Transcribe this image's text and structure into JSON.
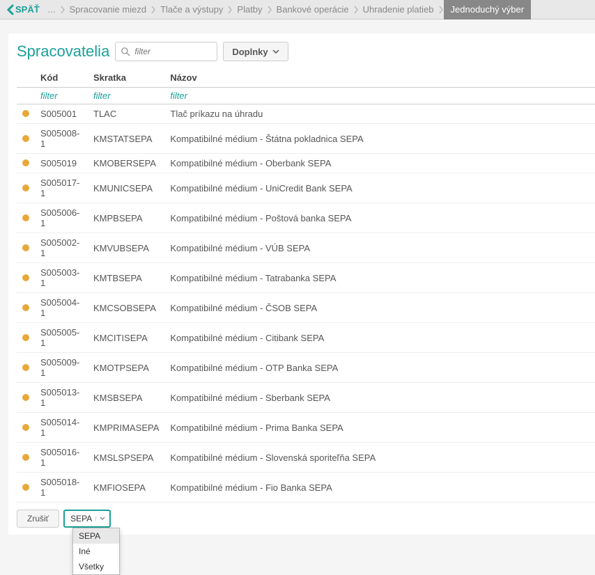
{
  "breadcrumb": {
    "back_label": "SPÄŤ",
    "ellipsis": "...",
    "items": [
      "Spracovanie miezd",
      "Tlače a výstupy",
      "Platby",
      "Bankové operácie",
      "Uhradenie platieb",
      "Jednoduchý výber"
    ]
  },
  "page_title": "Spracovatelia",
  "search": {
    "placeholder": "filter",
    "value": ""
  },
  "doplnky_label": "Doplnky",
  "columns": {
    "kod": "Kód",
    "skratka": "Skratka",
    "nazov": "Názov"
  },
  "filter_placeholder": "filter",
  "rows": [
    {
      "kod": "S005001",
      "skratka": "TLAC",
      "nazov": "Tlač príkazu na úhradu"
    },
    {
      "kod": "S005008-1",
      "skratka": "KMSTATSEPA",
      "nazov": "Kompatibilné médium - Štátna pokladnica SEPA"
    },
    {
      "kod": "S005019",
      "skratka": "KMOBERSEPA",
      "nazov": "Kompatibilné médium - Oberbank SEPA"
    },
    {
      "kod": "S005017-1",
      "skratka": "KMUNICSEPA",
      "nazov": "Kompatibilné médium - UniCredit Bank SEPA"
    },
    {
      "kod": "S005006-1",
      "skratka": "KMPBSEPA",
      "nazov": "Kompatibilné médium - Poštová banka SEPA"
    },
    {
      "kod": "S005002-1",
      "skratka": "KMVUBSEPA",
      "nazov": "Kompatibilné médium - VÚB SEPA"
    },
    {
      "kod": "S005003-1",
      "skratka": "KMTBSEPA",
      "nazov": "Kompatibilné médium - Tatrabanka SEPA"
    },
    {
      "kod": "S005004-1",
      "skratka": "KMCSOBSEPA",
      "nazov": "Kompatibilné médium - ČSOB SEPA"
    },
    {
      "kod": "S005005-1",
      "skratka": "KMCITISEPA",
      "nazov": "Kompatibilné médium - Citibank SEPA"
    },
    {
      "kod": "S005009-1",
      "skratka": "KMOTPSEPA",
      "nazov": "Kompatibilné médium - OTP Banka SEPA"
    },
    {
      "kod": "S005013-1",
      "skratka": "KMSBSEPA",
      "nazov": "Kompatibilné médium - Sberbank SEPA"
    },
    {
      "kod": "S005014-1",
      "skratka": "KMPRIMASEPA",
      "nazov": "Kompatibilné médium - Prima Banka SEPA"
    },
    {
      "kod": "S005016-1",
      "skratka": "KMSLSPSEPA",
      "nazov": "Kompatibilné médium - Slovenská sporiteľňa SEPA"
    },
    {
      "kod": "S005018-1",
      "skratka": "KMFIOSEPA",
      "nazov": "Kompatibilné médium - Fio Banka SEPA"
    }
  ],
  "footer": {
    "cancel_label": "Zrušiť",
    "filter_value": "SEPA",
    "dropdown_options": [
      "SEPA",
      "Iné",
      "Všetky"
    ]
  }
}
